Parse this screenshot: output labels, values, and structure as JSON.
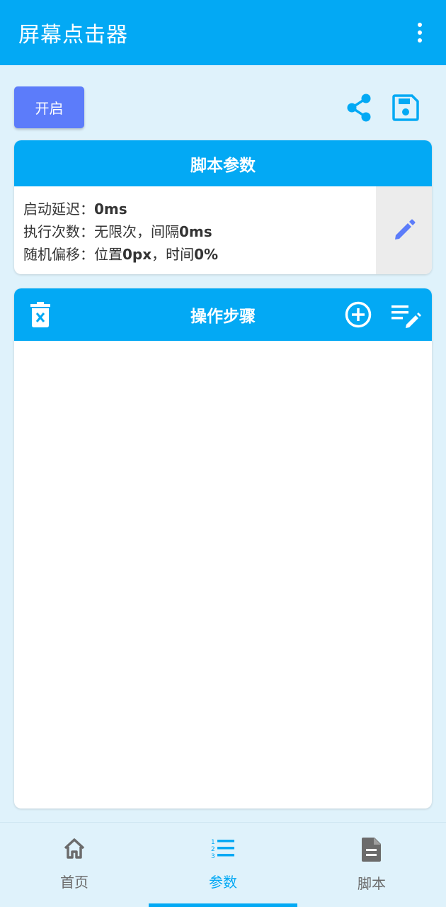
{
  "appbar": {
    "title": "屏幕点击器",
    "more_icon": "more-vert-icon"
  },
  "toolbar": {
    "start_label": "开启",
    "share_icon": "share-icon",
    "save_icon": "save-icon"
  },
  "params": {
    "header": "脚本参数",
    "line1_label": "启动延迟：",
    "line1_value": "0ms",
    "line2_label": "执行次数：无限次，间隔",
    "line2_value": "0ms",
    "line3_label1": "随机偏移：位置",
    "line3_value1": "0px",
    "line3_label2": "，时间",
    "line3_value2": "0%",
    "edit_icon": "pencil-icon"
  },
  "steps": {
    "header": "操作步骤",
    "delete_icon": "trash-icon",
    "add_icon": "add-circle-icon",
    "edit_list_icon": "edit-list-icon"
  },
  "nav": {
    "items": [
      {
        "label": "首页",
        "icon": "home-icon"
      },
      {
        "label": "参数",
        "icon": "numbered-list-icon"
      },
      {
        "label": "脚本",
        "icon": "document-icon"
      }
    ],
    "active_index": 1
  },
  "colors": {
    "primary": "#03a9f4",
    "accent_button": "#5c7cfa",
    "background": "#dff2fb",
    "icon_gray": "#6b6b6b"
  }
}
